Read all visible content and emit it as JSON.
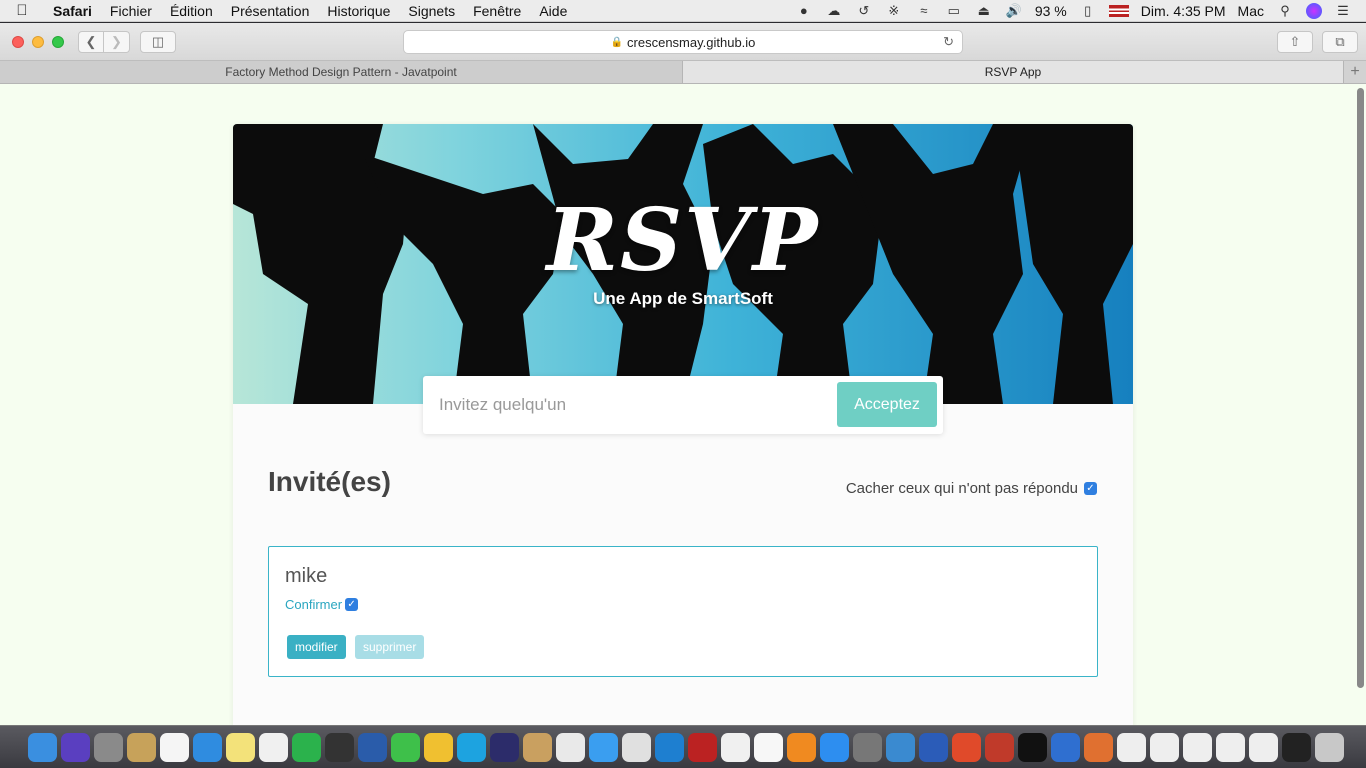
{
  "menubar": {
    "app": "Safari",
    "items": [
      "Fichier",
      "Édition",
      "Présentation",
      "Historique",
      "Signets",
      "Fenêtre",
      "Aide"
    ],
    "battery": "93 %",
    "clock": "Dim. 4:35 PM",
    "user": "Mac"
  },
  "browser": {
    "url": "crescensmay.github.io",
    "tabs": [
      {
        "label": "Factory Method Design Pattern - Javatpoint"
      },
      {
        "label": "RSVP App"
      }
    ]
  },
  "page": {
    "hero_title": "RSVP",
    "hero_subtitle": "Une App de SmartSoft",
    "invite": {
      "placeholder": "Invitez quelqu'un",
      "button": "Acceptez"
    },
    "guests_title": "Invité(es)",
    "hide_filter_label": "Cacher ceux qui n'ont pas répondu",
    "guests": [
      {
        "name": "mike",
        "confirm_label": "Confirmer",
        "edit": "modifier",
        "delete": "supprimer"
      }
    ]
  },
  "colors": {
    "page_bg": "#f6fef0",
    "accent": "#6fcfc4",
    "guest_border": "#3ab4c8",
    "checkbox": "#2f7fe0"
  },
  "dock": {
    "apps": [
      "finder-icon",
      "siri-icon",
      "launchpad-icon",
      "notes-icon",
      "calendar-icon",
      "safari-icon",
      "stickies-icon",
      "reminders-icon",
      "whatsapp-icon",
      "book-icon",
      "quicktime-icon",
      "wechat-icon",
      "android-icon",
      "skype-icon",
      "eclipse-icon",
      "preview-icon",
      "chrome-icon",
      "messages-icon",
      "timing-icon",
      "vpn-icon",
      "photobooth-icon",
      "itunes-icon",
      "photos-icon",
      "ibooks-icon",
      "appstore-icon",
      "system-preferences-icon",
      "xcode-icon",
      "word-icon",
      "powerpoint-icon",
      "edit-icon",
      "intellij-icon",
      "maps-icon",
      "tool-icon",
      "window-icon-1",
      "window-icon-2",
      "window-icon-3",
      "window-icon-4",
      "window-icon-5",
      "intellij-icon-2",
      "trash-icon"
    ]
  }
}
